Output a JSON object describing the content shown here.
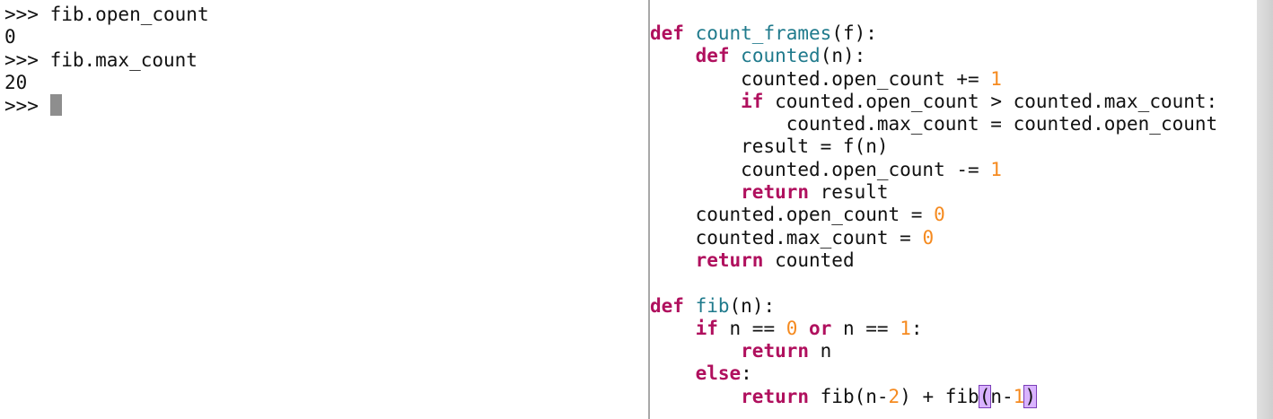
{
  "terminal": {
    "lines": [
      {
        "prompt": ">>> ",
        "text": "fib.open_count"
      },
      {
        "prompt": "",
        "text": "0"
      },
      {
        "prompt": ">>> ",
        "text": "fib.max_count"
      },
      {
        "prompt": "",
        "text": "20"
      },
      {
        "prompt": ">>> ",
        "text": ""
      }
    ]
  },
  "editor": {
    "lines": [
      [
        [
          "kw",
          "def"
        ],
        [
          "",
          " "
        ],
        [
          "fn",
          "count_frames"
        ],
        [
          "",
          "(f):"
        ]
      ],
      [
        [
          "",
          "    "
        ],
        [
          "kw",
          "def"
        ],
        [
          "",
          " "
        ],
        [
          "fn",
          "counted"
        ],
        [
          "",
          "(n):"
        ]
      ],
      [
        [
          "",
          "        counted.open_count += "
        ],
        [
          "num",
          "1"
        ]
      ],
      [
        [
          "",
          "        "
        ],
        [
          "kw",
          "if"
        ],
        [
          "",
          " counted.open_count > counted.max_count:"
        ]
      ],
      [
        [
          "",
          "            counted.max_count = counted.open_count"
        ]
      ],
      [
        [
          "",
          "        result = f(n)"
        ]
      ],
      [
        [
          "",
          "        counted.open_count -= "
        ],
        [
          "num",
          "1"
        ]
      ],
      [
        [
          "",
          "        "
        ],
        [
          "kw",
          "return"
        ],
        [
          "",
          " result"
        ]
      ],
      [
        [
          "",
          "    counted.open_count = "
        ],
        [
          "num",
          "0"
        ]
      ],
      [
        [
          "",
          "    counted.max_count = "
        ],
        [
          "num",
          "0"
        ]
      ],
      [
        [
          "",
          "    "
        ],
        [
          "kw",
          "return"
        ],
        [
          "",
          " counted"
        ]
      ],
      [
        [
          "",
          ""
        ]
      ],
      [
        [
          "kw",
          "def"
        ],
        [
          "",
          " "
        ],
        [
          "fn",
          "fib"
        ],
        [
          "",
          "(n):"
        ]
      ],
      [
        [
          "",
          "    "
        ],
        [
          "kw",
          "if"
        ],
        [
          "",
          " n == "
        ],
        [
          "num",
          "0"
        ],
        [
          "",
          " "
        ],
        [
          "kw",
          "or"
        ],
        [
          "",
          " n == "
        ],
        [
          "num",
          "1"
        ],
        [
          "",
          ":"
        ]
      ],
      [
        [
          "",
          "        "
        ],
        [
          "kw",
          "return"
        ],
        [
          "",
          " n"
        ]
      ],
      [
        [
          "",
          "    "
        ],
        [
          "kw",
          "else"
        ],
        [
          "",
          ":"
        ]
      ],
      [
        [
          "",
          "        "
        ],
        [
          "kw",
          "return"
        ],
        [
          "",
          " fib(n-"
        ],
        [
          "num",
          "2"
        ],
        [
          "",
          ") + fib"
        ],
        [
          "hl",
          "("
        ],
        [
          "",
          "n-"
        ],
        [
          "num",
          "1"
        ],
        [
          "hl",
          ")"
        ]
      ]
    ]
  }
}
